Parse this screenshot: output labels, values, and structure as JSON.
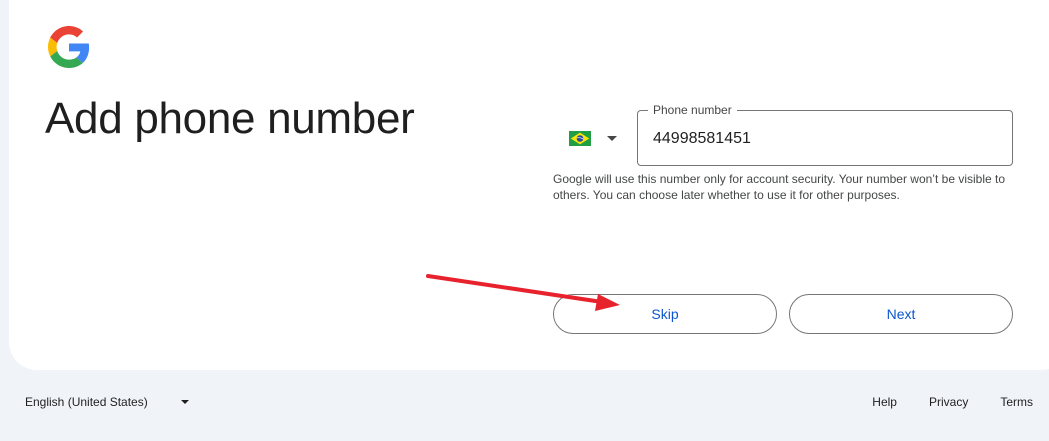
{
  "header": {
    "logo_icon": "google-g-logo-icon",
    "title": "Add phone number"
  },
  "phone": {
    "country_flag_icon": "brazil-flag-icon",
    "label": "Phone number",
    "value": "44998581451",
    "helper": "Google will use this number only for account security. Your number won’t be visible to others. You can choose later whether to use it for other purposes."
  },
  "actions": {
    "skip_label": "Skip",
    "next_label": "Next"
  },
  "annotation": {
    "arrow_icon": "red-arrow-icon",
    "arrow_color": "#e8222d"
  },
  "footer": {
    "language": "English (United States)",
    "links": [
      "Help",
      "Privacy",
      "Terms"
    ]
  },
  "colors": {
    "accent": "#0b57d0",
    "background": "#f0f4f9",
    "card": "#ffffff"
  }
}
